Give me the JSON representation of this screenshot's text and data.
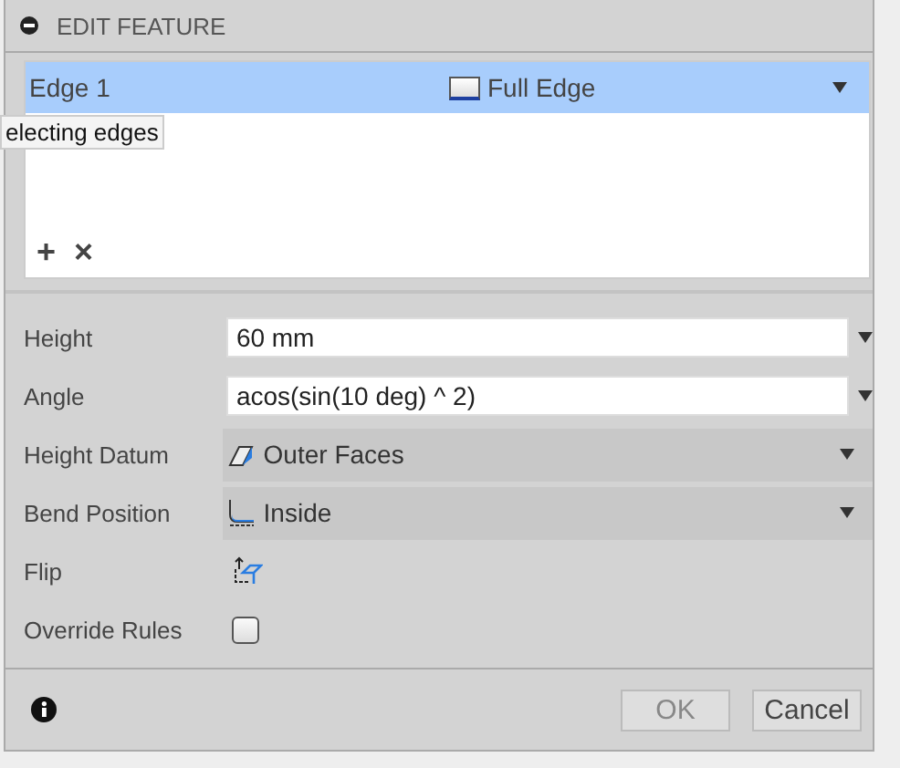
{
  "panel": {
    "title": "EDIT FEATURE",
    "expanded": true
  },
  "selection": {
    "rows": [
      {
        "name": "Edge 1",
        "option": "Full Edge",
        "selected": true
      }
    ],
    "tooltip": "electing edges",
    "add_label": "+",
    "remove_label": "×"
  },
  "fields": [
    {
      "kind": "input",
      "label": "Height",
      "value": "60 mm"
    },
    {
      "kind": "input",
      "label": "Angle",
      "value": "acos(sin(10 deg) ^ 2)"
    },
    {
      "kind": "dropdown",
      "label": "Height Datum",
      "value": "Outer Faces"
    },
    {
      "kind": "dropdown",
      "label": "Bend Position",
      "value": "Inside"
    },
    {
      "kind": "icon",
      "label": "Flip"
    },
    {
      "kind": "checkbox",
      "label": "Override Rules",
      "checked": false
    }
  ],
  "buttons": [
    {
      "label": "OK",
      "disabled": true
    },
    {
      "label": "Cancel",
      "disabled": false
    }
  ]
}
